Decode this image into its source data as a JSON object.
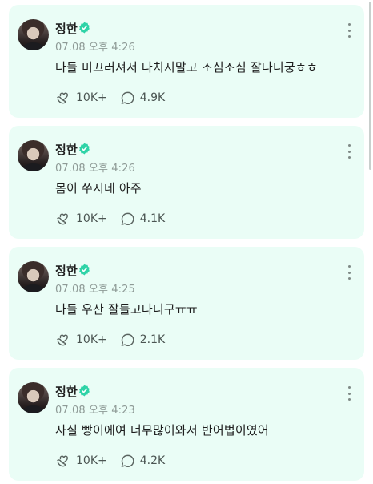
{
  "posts": [
    {
      "author": "정한",
      "time": "07.08 오후 4:26",
      "message": "다들 미끄러져서 다치지말고 조심조심 잘다니궁ㅎㅎ",
      "likes": "10K+",
      "comments": "4.9K"
    },
    {
      "author": "정한",
      "time": "07.08 오후 4:26",
      "message": "몸이 쑤시네 아주",
      "likes": "10K+",
      "comments": "4.1K"
    },
    {
      "author": "정한",
      "time": "07.08 오후 4:25",
      "message": "다들 우산 잘들고다니구ㅠㅠ",
      "likes": "10K+",
      "comments": "2.1K"
    },
    {
      "author": "정한",
      "time": "07.08 오후 4:23",
      "message": "사실 빵이에여 너무많이와서 반어법이였어",
      "likes": "10K+",
      "comments": "4.2K"
    }
  ],
  "icons": {
    "verified": "verified-badge-icon",
    "like": "heart-hand-icon",
    "comment": "comment-bubble-icon",
    "more": "more-vertical-icon"
  },
  "colors": {
    "card_bg": "#eafdf6",
    "badge": "#2ed3a7",
    "text": "#1d1d1d",
    "meta": "#8e9a96"
  }
}
